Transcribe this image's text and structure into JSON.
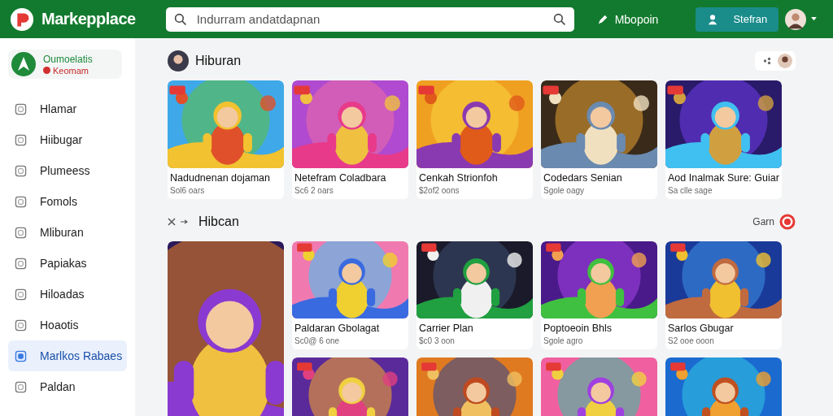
{
  "header": {
    "brand": "Markepplace",
    "search": {
      "placeholder": "Indurram andatdapnan"
    },
    "link": "Mbopoin",
    "button": "Stefran"
  },
  "sidebar": {
    "profile": {
      "name": "Oumoelatis",
      "status": "Keomam"
    },
    "items": [
      {
        "label": "Hlamar",
        "selected": false
      },
      {
        "label": "Hiibugar",
        "selected": false
      },
      {
        "label": "Plumeess",
        "selected": false
      },
      {
        "label": "Fomols",
        "selected": false
      },
      {
        "label": "Mliburan",
        "selected": false
      },
      {
        "label": "Papiakas",
        "selected": false
      },
      {
        "label": "Hiloadas",
        "selected": false
      },
      {
        "label": "Hoaotis",
        "selected": false
      },
      {
        "label": "Marlkos Rabaes",
        "selected": true
      },
      {
        "label": "Paldan",
        "selected": false
      }
    ]
  },
  "sections": [
    {
      "kind": "profile",
      "title": "Hiburan",
      "cards": [
        {
          "kind": "game",
          "title": "Nadudnenan dojaman",
          "meta": "Sol6 oars"
        },
        {
          "kind": "game",
          "title": "Netefram Coladbara",
          "meta": "Sc6 2 oars"
        },
        {
          "kind": "game",
          "title": "Cenkah Strionfoh",
          "meta": "$2of2 oons"
        },
        {
          "kind": "game",
          "title": "Codedars Senian",
          "meta": "Sgole oagy"
        },
        {
          "kind": "game",
          "title": "Aod Inalmak Sure: Guiar",
          "meta": "Sa clle sage"
        }
      ]
    },
    {
      "kind": "nav",
      "title": "Hibcan",
      "action": "Garn",
      "cards": [
        {
          "kind": "tall"
        },
        {
          "kind": "game",
          "title": "Paldaran Gbolagat",
          "meta": "Sc0@ 6 one"
        },
        {
          "kind": "game",
          "title": "Carrier Plan",
          "meta": "$c0 3 oon"
        },
        {
          "kind": "game",
          "title": "Poptoeoin Bhls",
          "meta": "Sgole agro"
        },
        {
          "kind": "game",
          "title": "Sarlos Gbugar",
          "meta": "S2 ooe ooon"
        },
        {
          "kind": "picture"
        },
        {
          "kind": "picture"
        },
        {
          "kind": "picture"
        },
        {
          "kind": "picture"
        }
      ]
    }
  ]
}
